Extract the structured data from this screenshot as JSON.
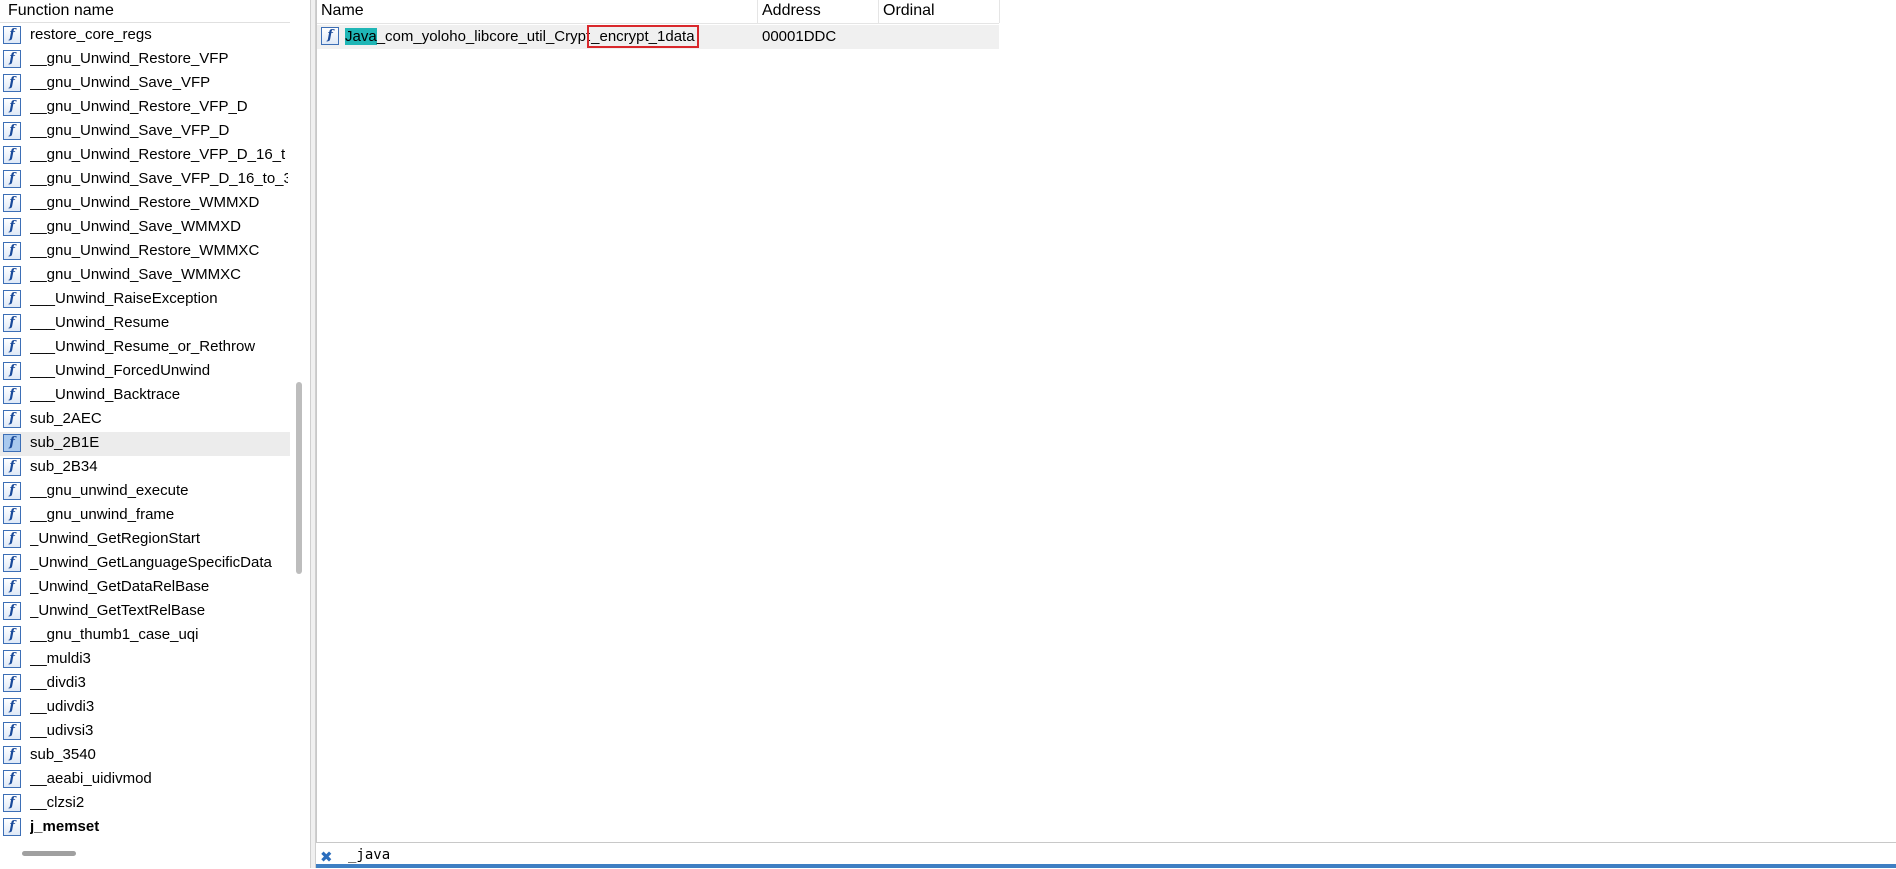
{
  "function_list": {
    "header": "Function name",
    "selected_index": 17,
    "items": [
      "restore_core_regs",
      "__gnu_Unwind_Restore_VFP",
      "__gnu_Unwind_Save_VFP",
      "__gnu_Unwind_Restore_VFP_D",
      "__gnu_Unwind_Save_VFP_D",
      "__gnu_Unwind_Restore_VFP_D_16_t",
      "__gnu_Unwind_Save_VFP_D_16_to_3",
      "__gnu_Unwind_Restore_WMMXD",
      "__gnu_Unwind_Save_WMMXD",
      "__gnu_Unwind_Restore_WMMXC",
      "__gnu_Unwind_Save_WMMXC",
      "___Unwind_RaiseException",
      "___Unwind_Resume",
      "___Unwind_Resume_or_Rethrow",
      "___Unwind_ForcedUnwind",
      "___Unwind_Backtrace",
      "sub_2AEC",
      "sub_2B1E",
      "sub_2B34",
      "__gnu_unwind_execute",
      "__gnu_unwind_frame",
      "_Unwind_GetRegionStart",
      "_Unwind_GetLanguageSpecificData",
      "_Unwind_GetDataRelBase",
      "_Unwind_GetTextRelBase",
      "__gnu_thumb1_case_uqi",
      "__muldi3",
      "__divdi3",
      "__udivdi3",
      "__udivsi3",
      "sub_3540",
      "__aeabi_uidivmod",
      "__clzsi2",
      "j_memset"
    ],
    "bold_items": [
      "j_memset"
    ],
    "icon_glyph": "f"
  },
  "exports": {
    "columns": {
      "name": "Name",
      "address": "Address",
      "ordinal": "Ordinal"
    },
    "row": {
      "name_prefix": "Java",
      "name_middle": "_com_yoloho_libcore_util_Crypt",
      "name_suffix": "_encrypt_1data",
      "address": "00001DDC",
      "ordinal": ""
    }
  },
  "filter_bar": {
    "close_glyph": "✖",
    "text": "_java"
  },
  "colors": {
    "highlight": "#1fb6b6",
    "annotation_box": "#d9282c",
    "icon_border": "#3d6fb6",
    "status_strip": "#3e7fc3"
  }
}
